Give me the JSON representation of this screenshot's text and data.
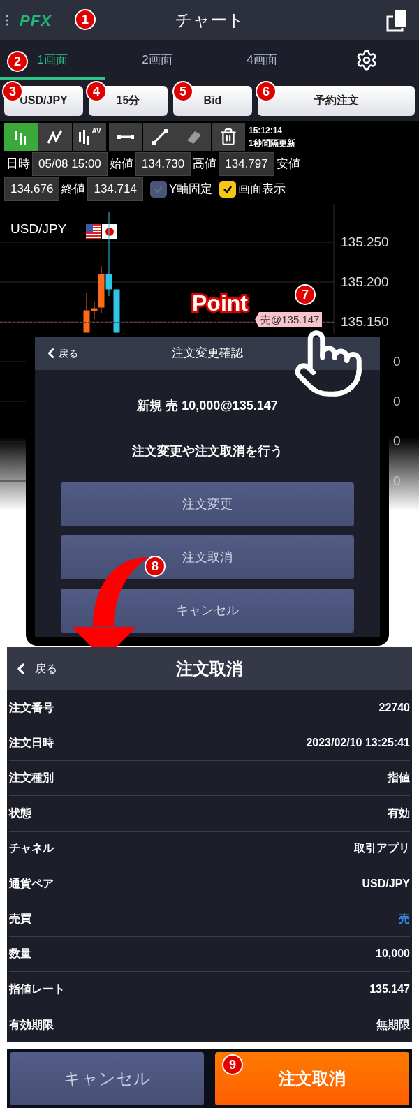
{
  "header": {
    "logo": "PFX",
    "title": "チャート"
  },
  "tabs": [
    {
      "label": "1画面",
      "selected": true
    },
    {
      "label": "2画面",
      "selected": false
    },
    {
      "label": "4画面",
      "selected": false
    }
  ],
  "selectors": [
    "USD/JPY",
    "15分",
    "Bid",
    "予約注文"
  ],
  "tools": [
    {
      "kind": "candles",
      "selected": true
    },
    {
      "kind": "line",
      "selected": false
    },
    {
      "kind": "candles_av",
      "badge": "AV",
      "selected": false
    },
    {
      "kind": "range",
      "selected": false
    },
    {
      "kind": "trendline",
      "selected": false
    },
    {
      "kind": "eraser",
      "selected": false
    },
    {
      "kind": "trash",
      "selected": false
    }
  ],
  "update": {
    "time": "15:12:14",
    "interval": "1秒間隔更新"
  },
  "ohlc": [
    {
      "kind": "label",
      "text": "日時"
    },
    {
      "kind": "value",
      "text": "05/08 15:00"
    },
    {
      "kind": "label",
      "text": "始値"
    },
    {
      "kind": "value",
      "text": "134.730"
    },
    {
      "kind": "label",
      "text": "高値"
    },
    {
      "kind": "value",
      "text": "134.797"
    },
    {
      "kind": "label",
      "text": "安値"
    },
    {
      "kind": "value",
      "text": "134.676"
    },
    {
      "kind": "label",
      "text": "終値"
    },
    {
      "kind": "value",
      "text": "134.714"
    }
  ],
  "options": [
    {
      "label": "Y軸固定",
      "checked": false
    },
    {
      "label": "画面表示",
      "checked": true
    }
  ],
  "chart": {
    "pair": "USD/JPY",
    "axis_labels": [
      "135.250",
      "135.200",
      "135.150",
      "0",
      "0",
      "0",
      "0"
    ],
    "order_tag": "売@135.147"
  },
  "dialog": {
    "back": "戻る",
    "title": "注文変更確認",
    "order": "新規 売 10,000@135.147",
    "message": "注文変更や注文取消を行う",
    "buttons": [
      "注文変更",
      "注文取消",
      "キャンセル"
    ]
  },
  "cancel_screen": {
    "back": "戻る",
    "title": "注文取消",
    "rows": [
      {
        "label": "注文番号",
        "value": "22740"
      },
      {
        "label": "注文日時",
        "value": "2023/02/10 13:25:41"
      },
      {
        "label": "注文種別",
        "value": "指値"
      },
      {
        "label": "状態",
        "value": "有効"
      },
      {
        "label": "チャネル",
        "value": "取引アプリ"
      },
      {
        "label": "通貨ペア",
        "value": "USD/JPY"
      },
      {
        "label": "売買",
        "value": "売",
        "color": "#3d8ef0"
      },
      {
        "label": "数量",
        "value": "10,000"
      },
      {
        "label": "指値レート",
        "value": "135.147"
      },
      {
        "label": "有効期限",
        "value": "無期限"
      }
    ]
  },
  "footer_buttons": [
    {
      "label": "キャンセル",
      "kind": "secondary"
    },
    {
      "label": "注文取消",
      "kind": "primary"
    }
  ],
  "annotations": {
    "point": "Point",
    "markers": [
      "1",
      "2",
      "3",
      "4",
      "5",
      "6",
      "7",
      "8",
      "9"
    ]
  }
}
